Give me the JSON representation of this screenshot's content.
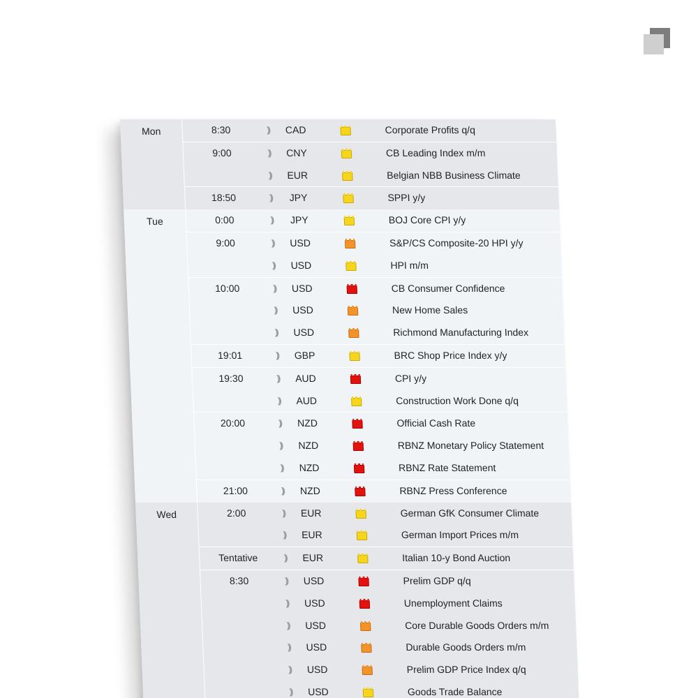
{
  "days": [
    {
      "day": "Mon",
      "rows": [
        {
          "time": "8:30",
          "currency": "CAD",
          "impact": "low",
          "event": "Corporate Profits q/q",
          "sep": false
        },
        {
          "time": "9:00",
          "currency": "CNY",
          "impact": "low",
          "event": "CB Leading Index m/m",
          "sep": true
        },
        {
          "time": "",
          "currency": "EUR",
          "impact": "low",
          "event": "Belgian NBB Business Climate",
          "sep": false
        },
        {
          "time": "18:50",
          "currency": "JPY",
          "impact": "low",
          "event": "SPPI y/y",
          "sep": true
        }
      ]
    },
    {
      "day": "Tue",
      "rows": [
        {
          "time": "0:00",
          "currency": "JPY",
          "impact": "low",
          "event": "BOJ Core CPI y/y",
          "sep": false
        },
        {
          "time": "9:00",
          "currency": "USD",
          "impact": "medium",
          "event": "S&P/CS Composite-20 HPI y/y",
          "sep": true
        },
        {
          "time": "",
          "currency": "USD",
          "impact": "low",
          "event": "HPI m/m",
          "sep": false
        },
        {
          "time": "10:00",
          "currency": "USD",
          "impact": "high",
          "event": "CB Consumer Confidence",
          "sep": true
        },
        {
          "time": "",
          "currency": "USD",
          "impact": "medium",
          "event": "New Home Sales",
          "sep": false
        },
        {
          "time": "",
          "currency": "USD",
          "impact": "medium",
          "event": "Richmond Manufacturing Index",
          "sep": false
        },
        {
          "time": "19:01",
          "currency": "GBP",
          "impact": "low",
          "event": "BRC Shop Price Index y/y",
          "sep": true
        },
        {
          "time": "19:30",
          "currency": "AUD",
          "impact": "high",
          "event": "CPI y/y",
          "sep": true
        },
        {
          "time": "",
          "currency": "AUD",
          "impact": "low",
          "event": "Construction Work Done q/q",
          "sep": false
        },
        {
          "time": "20:00",
          "currency": "NZD",
          "impact": "high",
          "event": "Official Cash Rate",
          "sep": true
        },
        {
          "time": "",
          "currency": "NZD",
          "impact": "high",
          "event": "RBNZ Monetary Policy Statement",
          "sep": false
        },
        {
          "time": "",
          "currency": "NZD",
          "impact": "high",
          "event": "RBNZ Rate Statement",
          "sep": false
        },
        {
          "time": "21:00",
          "currency": "NZD",
          "impact": "high",
          "event": "RBNZ Press Conference",
          "sep": true
        }
      ]
    },
    {
      "day": "Wed",
      "rows": [
        {
          "time": "2:00",
          "currency": "EUR",
          "impact": "low",
          "event": "German GfK Consumer Climate",
          "sep": false
        },
        {
          "time": "",
          "currency": "EUR",
          "impact": "low",
          "event": "German Import Prices m/m",
          "sep": false
        },
        {
          "time": "Tentative",
          "currency": "EUR",
          "impact": "low",
          "event": "Italian 10-y Bond Auction",
          "sep": true
        },
        {
          "time": "8:30",
          "currency": "USD",
          "impact": "high",
          "event": "Prelim GDP q/q",
          "sep": true
        },
        {
          "time": "",
          "currency": "USD",
          "impact": "high",
          "event": "Unemployment Claims",
          "sep": false
        },
        {
          "time": "",
          "currency": "USD",
          "impact": "medium",
          "event": "Core Durable Goods Orders m/m",
          "sep": false
        },
        {
          "time": "",
          "currency": "USD",
          "impact": "medium",
          "event": "Durable Goods Orders m/m",
          "sep": false
        },
        {
          "time": "",
          "currency": "USD",
          "impact": "medium",
          "event": "Prelim GDP Price Index q/q",
          "sep": false
        },
        {
          "time": "",
          "currency": "USD",
          "impact": "low",
          "event": "Goods Trade Balance",
          "sep": false
        }
      ]
    }
  ],
  "icons": {
    "sound": "sound-alert-icon",
    "impact": "impact-folder-icon"
  },
  "colors": {
    "low": "#f5d61d",
    "medium": "#f3942a",
    "high": "#e2120f",
    "rowOdd": "#e6e7ea",
    "rowEven": "#f1f4f7"
  }
}
